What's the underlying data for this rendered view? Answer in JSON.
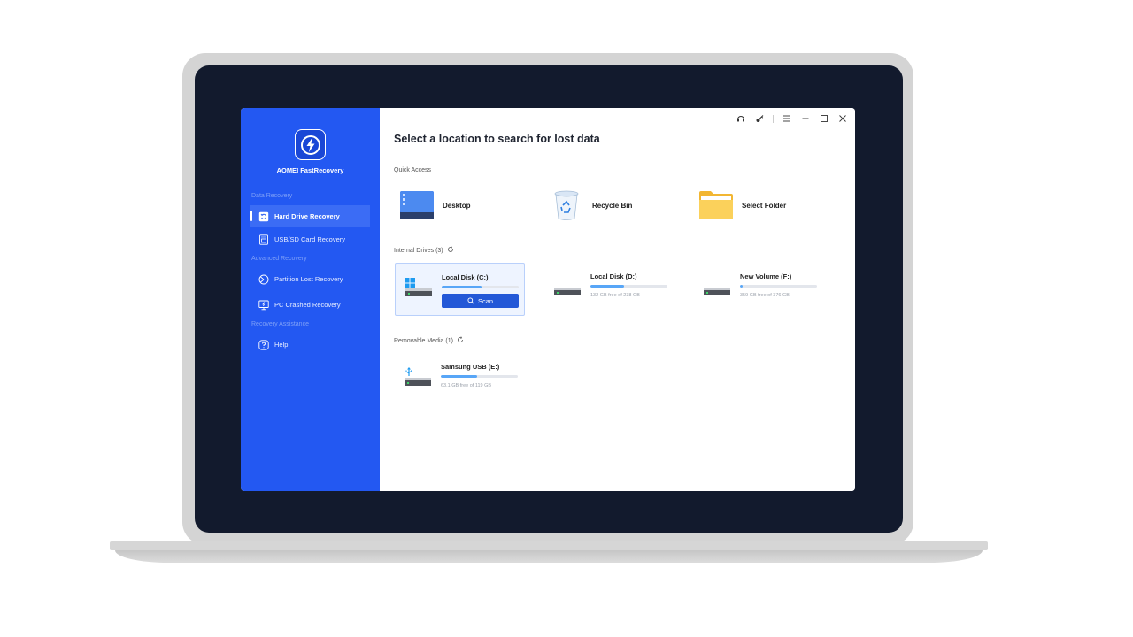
{
  "app": {
    "brand": "AOMEI FastRecovery"
  },
  "sidebar": {
    "sections": [
      {
        "label": "Data Recovery"
      },
      {
        "label": "Advanced Recovery"
      },
      {
        "label": "Recovery Assistance"
      }
    ],
    "items": [
      {
        "label": "Hard Drive Recovery",
        "icon": "restore-icon",
        "active": true
      },
      {
        "label": "USB/SD Card Recovery",
        "icon": "sd-card-icon",
        "active": false
      },
      {
        "label": "Partition Lost Recovery",
        "icon": "partition-icon",
        "active": false
      },
      {
        "label": "PC Crashed Recovery",
        "icon": "monitor-icon",
        "active": false
      },
      {
        "label": "Help",
        "icon": "help-icon",
        "active": false
      }
    ]
  },
  "main": {
    "title": "Select a location to search for lost data",
    "quick_access": {
      "label": "Quick Access",
      "items": [
        {
          "label": "Desktop",
          "icon": "desktop-icon"
        },
        {
          "label": "Recycle Bin",
          "icon": "recycle-bin-icon"
        },
        {
          "label": "Select Folder",
          "icon": "folder-icon"
        }
      ]
    },
    "internal_drives": {
      "label": "Internal Drives (3)",
      "drives": [
        {
          "name": "Local Disk (C:)",
          "used_fraction": 0.52,
          "free": "",
          "selected": true,
          "scan_label": "Scan"
        },
        {
          "name": "Local Disk (D:)",
          "used_fraction": 0.44,
          "free": "132 GB free of 238 GB",
          "selected": false
        },
        {
          "name": "New Volume (F:)",
          "used_fraction": 0.03,
          "free": "359 GB free of 376 GB",
          "selected": false
        }
      ]
    },
    "removable_media": {
      "label": "Removable Media (1)",
      "drives": [
        {
          "name": "Samsung USB (E:)",
          "used_fraction": 0.47,
          "free": "63.1 GB free of 119 GB",
          "selected": false
        }
      ]
    }
  },
  "colors": {
    "sidebar": "#2358f2",
    "accent": "#2358d7",
    "progress": "#58a6f7",
    "screen_bezel": "#121a2d"
  }
}
